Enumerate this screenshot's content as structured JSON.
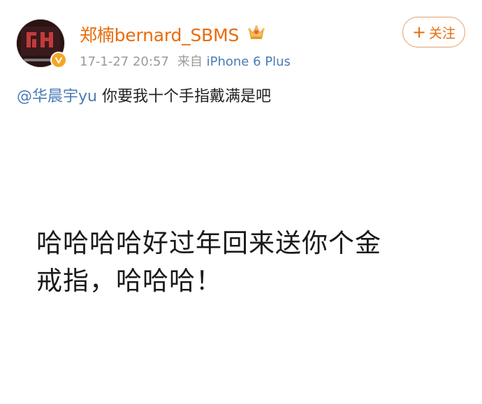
{
  "header": {
    "username": "郑楠bernard_SBMS",
    "timestamp": "17-1-27 20:57",
    "source_prefix": "来自",
    "device": "iPhone 6 Plus",
    "follow_label": "关注",
    "follow_plus": "+",
    "avatar_icon": "avatar-image",
    "verified_icon": "verified-v-icon",
    "member_icon": "crown-icon"
  },
  "post": {
    "mention": "@华晨宇yu",
    "text": "你要我十个手指戴满是吧"
  },
  "image": {
    "line1": "哈哈哈哈好过年回来送你个金",
    "line2": "戒指，哈哈哈！"
  },
  "colors": {
    "username": "#e86b0c",
    "link": "#4a7bb7",
    "meta": "#9a9a9a",
    "badge": "#f5a623"
  }
}
